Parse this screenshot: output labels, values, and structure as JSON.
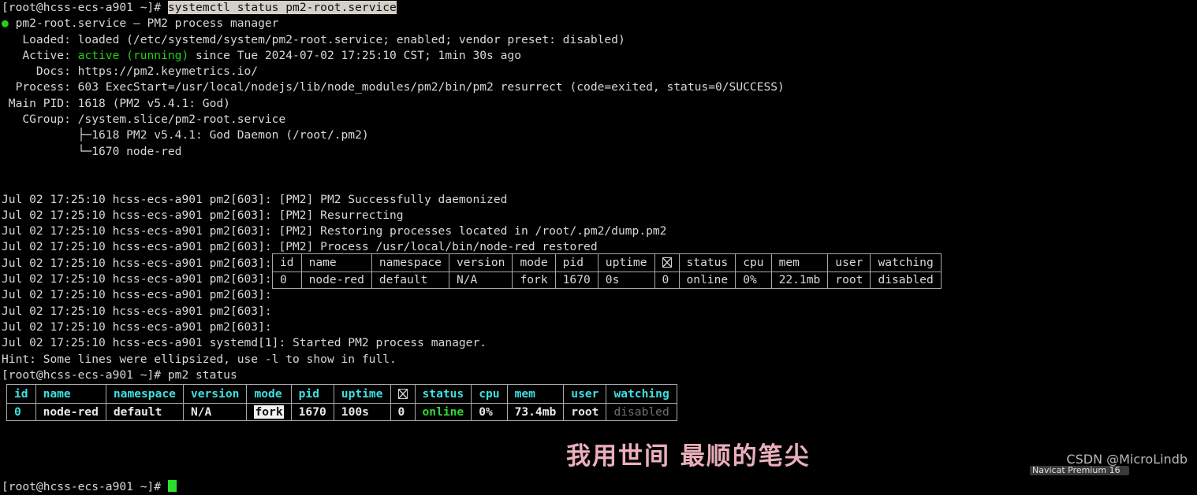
{
  "terminal": {
    "prompt": "[root@hcss-ecs-a901 ~]#",
    "command_selected": "systemctl status pm2-root.service",
    "service_header": "pm2-root.service – PM2 process manager",
    "lines": [
      "   Loaded: loaded (/etc/systemd/system/pm2-root.service; enabled; vendor preset: disabled)",
      "   Active: ",
      "     Docs: https://pm2.keymetrics.io/",
      "  Process: 603 ExecStart=/usr/local/nodejs/lib/node_modules/pm2/bin/pm2 resurrect (code=exited, status=0/SUCCESS)",
      " Main PID: 1618 (PM2 v5.4.1: God)",
      "   CGroup: /system.slice/pm2-root.service",
      "           ├─1618 PM2 v5.4.1: God Daemon (/root/.pm2)",
      "           └─1670 node-red"
    ],
    "active_label": "   Active: ",
    "active_state": "active (running)",
    "active_rest": " since Tue 2024-07-02 17:25:10 CST; 1min 30s ago",
    "journal_lines": [
      "Jul 02 17:25:10 hcss-ecs-a901 pm2[603]: [PM2] PM2 Successfully daemonized",
      "Jul 02 17:25:10 hcss-ecs-a901 pm2[603]: [PM2] Resurrecting",
      "Jul 02 17:25:10 hcss-ecs-a901 pm2[603]: [PM2] Restoring processes located in /root/.pm2/dump.pm2",
      "Jul 02 17:25:10 hcss-ecs-a901 pm2[603]: [PM2] Process /usr/local/bin/node-red restored",
      "Jul 02 17:25:10 hcss-ecs-a901 pm2[603]:",
      "Jul 02 17:25:10 hcss-ecs-a901 pm2[603]:",
      "Jul 02 17:25:10 hcss-ecs-a901 pm2[603]:",
      "Jul 02 17:25:10 hcss-ecs-a901 pm2[603]:",
      "Jul 02 17:25:10 hcss-ecs-a901 pm2[603]:"
    ],
    "systemd_started_line": "Jul 02 17:25:10 hcss-ecs-a901 systemd[1]: Started PM2 process manager.",
    "hint_line": "Hint: Some lines were ellipsized, use -l to show in full.",
    "second_command": " pm2 status"
  },
  "table1": {
    "headers": [
      "id",
      "name",
      "namespace",
      "version",
      "mode",
      "pid",
      "uptime",
      "⌧",
      "status",
      "cpu",
      "mem",
      "user",
      "watching"
    ],
    "rows": [
      [
        "0",
        "node-red",
        "default",
        "N/A",
        "fork",
        "1670",
        "0s",
        "0",
        "online",
        "0%",
        "22.1mb",
        "root",
        "disabled"
      ]
    ]
  },
  "table2": {
    "headers": [
      "id",
      "name",
      "namespace",
      "version",
      "mode",
      "pid",
      "uptime",
      "⌧",
      "status",
      "cpu",
      "mem",
      "user",
      "watching"
    ],
    "rows": [
      [
        "0",
        "node-red",
        "default",
        "N/A",
        "fork",
        "1670",
        "100s",
        "0",
        "online",
        "0%",
        "73.4mb",
        "root",
        "disabled"
      ]
    ],
    "highlighted_cell": "fork"
  },
  "watermarks": {
    "chinese_text": "我用世间 最顺的笔尖",
    "csdn_text": "CSDN @MicroLindb",
    "taskbar_text": "Navicat Premium 16"
  },
  "colors": {
    "background": "#000000",
    "foreground": "#d8d8d8",
    "green": "#23d018",
    "cyan": "#3fe0e0",
    "dim": "#707070",
    "selection_bg": "#d4d0c8",
    "pink": "#f7b9c4"
  }
}
